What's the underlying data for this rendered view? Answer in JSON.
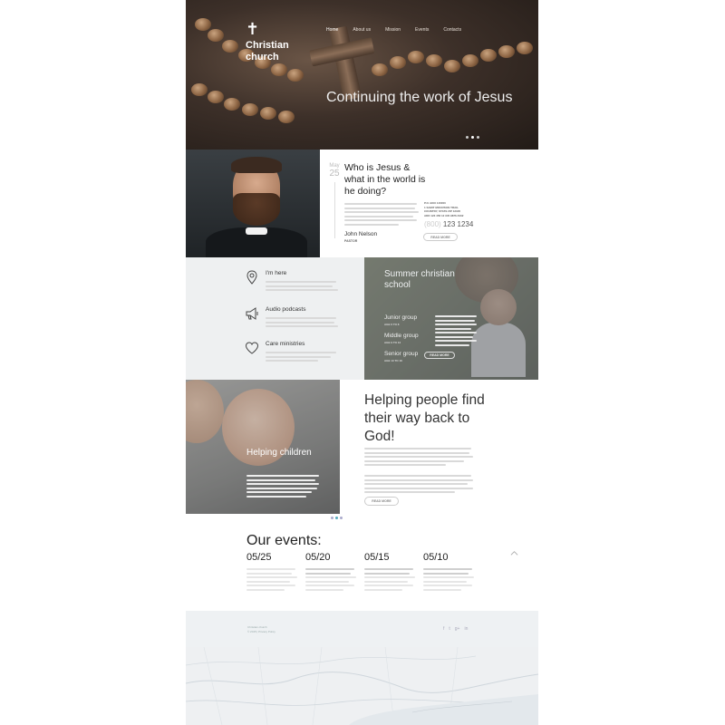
{
  "site": {
    "logo_glyph": "✝",
    "logo_name": "Christian church"
  },
  "nav": {
    "items": [
      "Home",
      "About us",
      "Mission",
      "Events",
      "Contacts"
    ],
    "active_index": 0
  },
  "hero": {
    "title": "Continuing the work of Jesus"
  },
  "pastor": {
    "date_month": "May",
    "date_day": "25",
    "question": "Who is Jesus & what in the world is he doing?",
    "name": "John Nelson",
    "role": "PASTOR",
    "address_lines": [
      "P.O. BOX 140000",
      "1 SAINT MOUNTAIN TRAIL",
      "COUNTRY, STATE ZIP 12345",
      "ADD 123 456 12 345 9876-5432"
    ],
    "phone_prefix": "(800)",
    "phone_number": "123 1234",
    "button": "READ MORE"
  },
  "services": [
    {
      "icon": "map-pin-icon",
      "title": "I'm here"
    },
    {
      "icon": "megaphone-icon",
      "title": "Audio podcasts"
    },
    {
      "icon": "heart-icon",
      "title": "Care ministries"
    }
  ],
  "school": {
    "title": "Summer christian school",
    "groups": [
      {
        "name": "Junior group",
        "age": "AGE 6 TO 8"
      },
      {
        "name": "Middle group",
        "age": "AGE 9 TO 12"
      },
      {
        "name": "Senior group",
        "age": "AGE 13 TO 16"
      }
    ],
    "button": "READ MORE"
  },
  "helping": {
    "children_title": "Helping children",
    "title": "Helping people find their way back to God!",
    "button": "READ MORE"
  },
  "events": {
    "heading": "Our events:",
    "items": [
      {
        "date": "05/25"
      },
      {
        "date": "05/20"
      },
      {
        "date": "05/15"
      },
      {
        "date": "05/10"
      }
    ]
  },
  "footer": {
    "line1": "Christian church",
    "line2": "© 2015 | Privacy Policy",
    "social": [
      "f",
      "t",
      "g+",
      "in"
    ]
  },
  "colors": {
    "hero_dark": "#2a211c",
    "panel_grey": "#eef0f1",
    "accent_text": "#222222"
  }
}
